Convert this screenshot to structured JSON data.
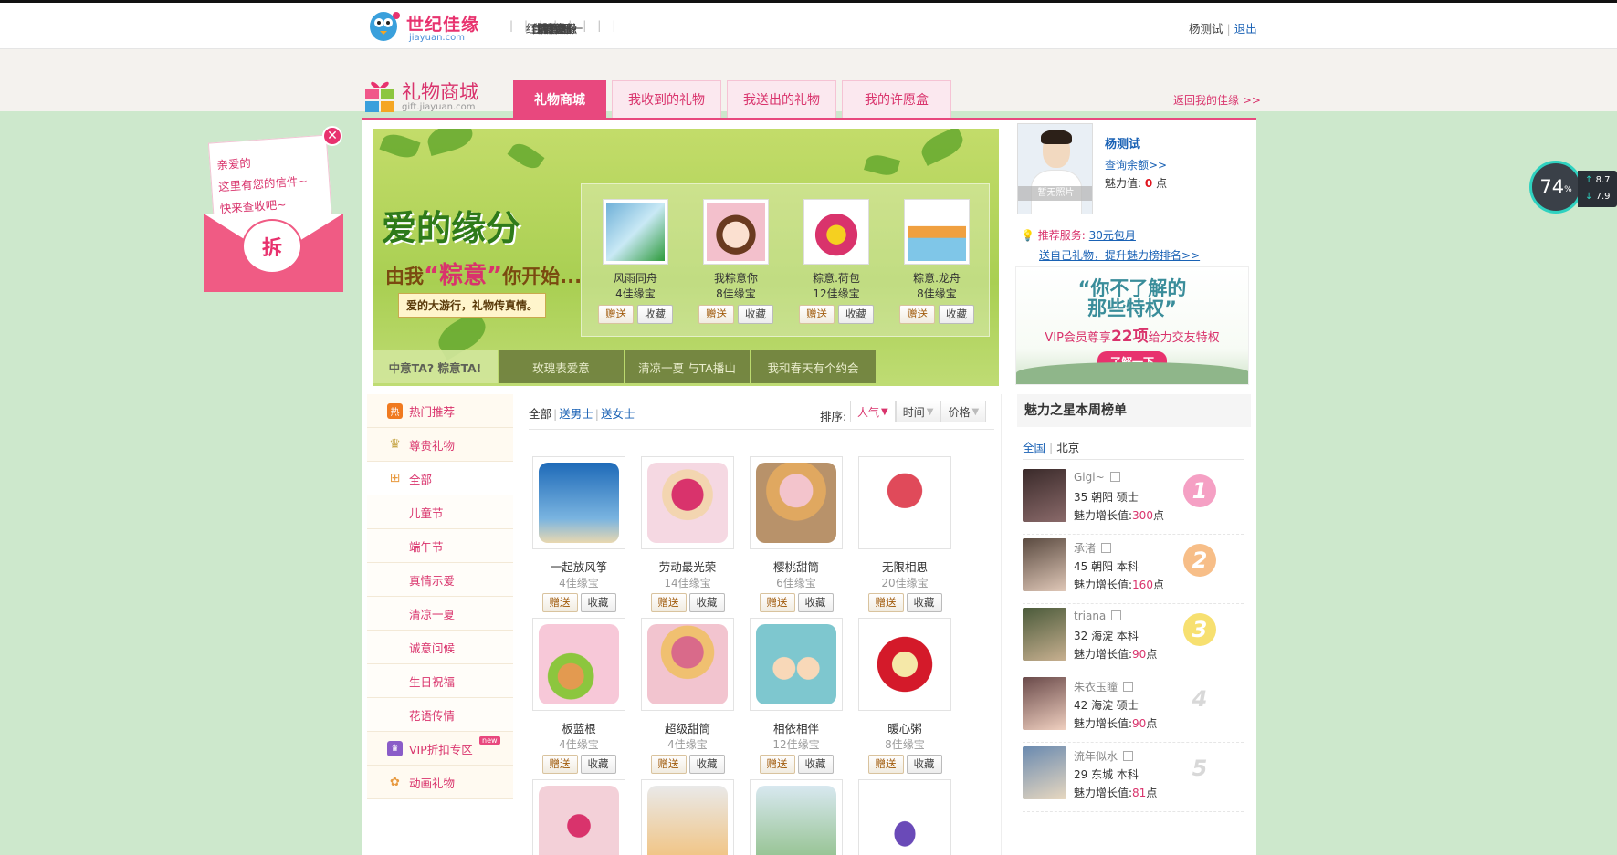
{
  "topnav": {
    "logo_text": "世纪佳缘",
    "logo_sub": "jiayuan.com",
    "items": [
      "首页",
      "我的佳缘",
      "搜索",
      "俱乐部",
      "活动",
      "约会吧",
      "佳缘金融",
      "红娘一对一",
      "晒幸福"
    ],
    "user_name": "杨测试",
    "logout": "退出"
  },
  "gift_header": {
    "title": "礼物商城",
    "subtitle": "gift.jiayuan.com",
    "tabs": [
      "礼物商城",
      "我收到的礼物",
      "我送出的礼物",
      "我的许愿盒"
    ],
    "back_link": "返回我的佳缘 >>"
  },
  "banner": {
    "title": "爱的缘分",
    "slogan_pre": "由我",
    "slogan_key": "“粽意”",
    "slogan_post": "你开始...",
    "tag": "爱的大游行，礼物传真情。",
    "featured": [
      {
        "name": "风雨同舟",
        "price": "4佳缘宝",
        "color": "#6fb0d8"
      },
      {
        "name": "我粽意你",
        "price": "8佳缘宝",
        "color": "#f3c0cc"
      },
      {
        "name": "粽意.荷包",
        "price": "12佳缘宝",
        "color": "#d9336c"
      },
      {
        "name": "粽意.龙舟",
        "price": "8佳缘宝",
        "color": "#7fc6e8"
      }
    ],
    "gift_btn": "赠送",
    "fav_btn": "收藏",
    "tabs": [
      "中意TA? 粽意TA!",
      "玫瑰表爱意",
      "清凉一夏 与TA播山",
      "我和春天有个约会"
    ]
  },
  "left_menu": {
    "items": [
      {
        "label": "热门推荐",
        "icon": "hot-icon",
        "type": "main"
      },
      {
        "label": "尊贵礼物",
        "icon": "crown-icon",
        "type": "main"
      },
      {
        "label": "全部",
        "icon": "gift-box-icon",
        "type": "main"
      },
      {
        "label": "儿童节",
        "type": "sub"
      },
      {
        "label": "端午节",
        "type": "sub"
      },
      {
        "label": "真情示爱",
        "type": "sub"
      },
      {
        "label": "清凉一夏",
        "type": "sub"
      },
      {
        "label": "诚意问候",
        "type": "sub"
      },
      {
        "label": "生日祝福",
        "type": "sub"
      },
      {
        "label": "花语传情",
        "type": "sub"
      },
      {
        "label": "VIP折扣专区",
        "icon": "vip-crown-icon",
        "type": "main",
        "badge": "new"
      },
      {
        "label": "动画礼物",
        "icon": "animation-icon",
        "type": "main"
      }
    ]
  },
  "filter": {
    "all": "全部",
    "male": "送男士",
    "female": "送女士",
    "sort_label": "排序:",
    "sorts": [
      "人气",
      "时间",
      "价格"
    ]
  },
  "gifts": [
    {
      "name": "一起放风筝",
      "price": "4佳缘宝",
      "color": "#3b78c8"
    },
    {
      "name": "劳动最光荣",
      "price": "14佳缘宝",
      "color": "#f5d8e2"
    },
    {
      "name": "樱桃甜筒",
      "price": "6佳缘宝",
      "color": "#b8926a"
    },
    {
      "name": "无限相思",
      "price": "20佳缘宝",
      "color": "#ffffff"
    },
    {
      "name": "板蓝根",
      "price": "4佳缘宝",
      "color": "#f7c8d8"
    },
    {
      "name": "超级甜筒",
      "price": "4佳缘宝",
      "color": "#f2c4cf"
    },
    {
      "name": "相依相伴",
      "price": "12佳缘宝",
      "color": "#7ec7cf"
    },
    {
      "name": "暖心粥",
      "price": "8佳缘宝",
      "color": "#ffffff"
    },
    {
      "name": "",
      "price": "",
      "color": "#f3d0d8"
    },
    {
      "name": "",
      "price": "",
      "color": "#f2c078"
    },
    {
      "name": "",
      "price": "",
      "color": "#8fbf88"
    },
    {
      "name": "",
      "price": "",
      "color": "#ffffff"
    }
  ],
  "gift_btn": "赠送",
  "fav_btn": "收藏",
  "profile": {
    "name": "杨测试",
    "no_photo": "暂无照片",
    "balance_link": "查询余额>>",
    "charm_label": "魅力值:",
    "charm_value": "0",
    "charm_unit": "点",
    "rec_label": "推荐服务:",
    "rec_link": "30元包月",
    "rec_link2": "送自己礼物，提升魅力榜排名>>"
  },
  "vip_ad": {
    "line1": "“你不了解的",
    "line2": "那些特权”",
    "line3_pre": "VIP会员尊享",
    "line3_num": "22项",
    "line3_post": "给力交友特权",
    "button": "了解一下"
  },
  "ranking": {
    "title": "魅力之星本周榜单",
    "filter_all": "全国",
    "filter_city": "北京",
    "growth_label": "魅力增长值:",
    "unit": "点",
    "users": [
      {
        "name": "Gigi~",
        "info": "35 朝阳 硕士",
        "growth": "300",
        "rank": "1",
        "color": "#3a2a2a",
        "badge": "#f5a0c4"
      },
      {
        "name": "承渚",
        "info": "45 朝阳 本科",
        "growth": "160",
        "rank": "2",
        "color": "#5a4a40",
        "badge": "#f7be88"
      },
      {
        "name": "triana",
        "info": "32 海淀 本科",
        "growth": "90",
        "rank": "3",
        "color": "#4a5a3a",
        "badge": "#f7e070"
      },
      {
        "name": "朱衣玉瞳",
        "info": "42 海淀 硕士",
        "growth": "90",
        "rank": "4",
        "color": "#6a4a4a",
        "badge": ""
      },
      {
        "name": "流年似水",
        "info": "29 东城 本科",
        "growth": "81",
        "rank": "5",
        "color": "#6a8ab0",
        "badge": ""
      }
    ]
  },
  "envelope": {
    "line1": "亲爱的",
    "line2": "这里有您的信件~",
    "line3": "快来查收吧~",
    "open": "拆"
  },
  "speed_widget": {
    "percent": "74",
    "unit": "%",
    "up": "8.7",
    "down": "7.9"
  }
}
